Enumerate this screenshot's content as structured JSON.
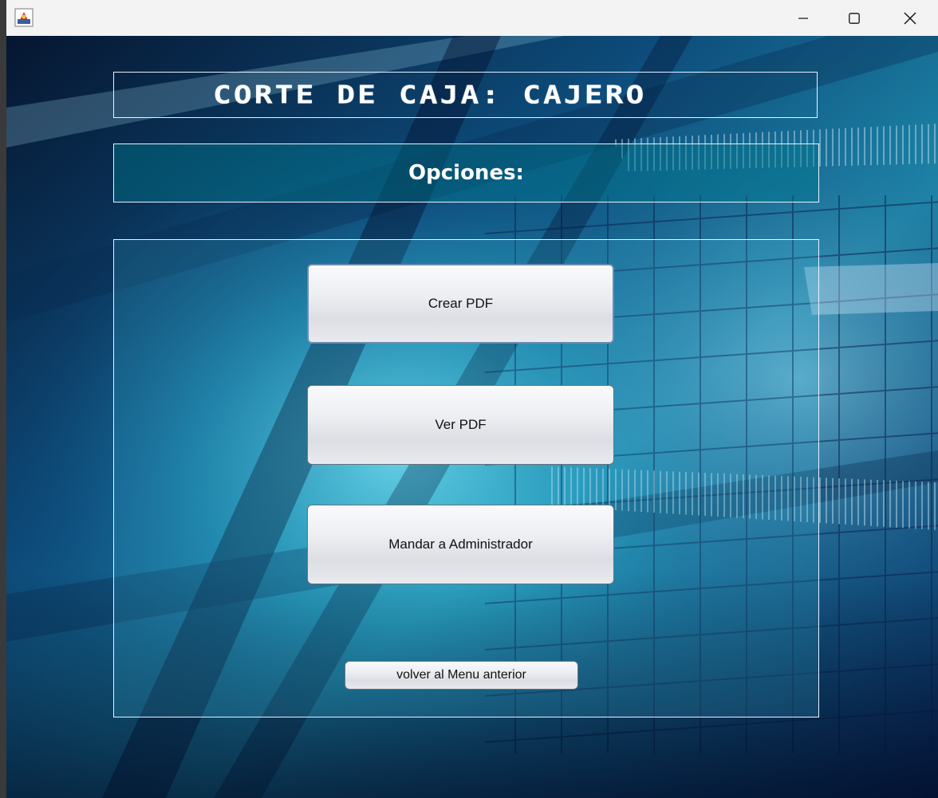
{
  "window": {
    "title": "",
    "controls": {
      "minimize": "minimize",
      "maximize": "maximize",
      "close": "close"
    }
  },
  "header": {
    "title": "CORTE DE CAJA: CAJERO"
  },
  "section": {
    "subtitle": "Opciones:"
  },
  "actions": {
    "create_pdf": "Crear PDF",
    "view_pdf": "Ver PDF",
    "send_admin": "Mandar a Administrador",
    "back": "volver al Menu anterior"
  },
  "colors": {
    "panel_border": "#e8f2ff",
    "title_text": "#ffffff",
    "button_text": "#111111",
    "background_primary": "#0b3d7a",
    "background_accent": "#2fb7d4"
  }
}
